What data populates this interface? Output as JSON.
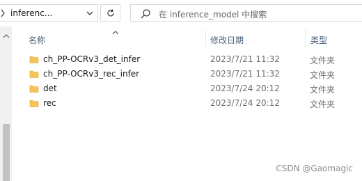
{
  "address_bar": {
    "path": "inferenc..."
  },
  "search": {
    "placeholder": "在 inference_model 中搜索"
  },
  "columns": {
    "name": "名称",
    "date": "修改日期",
    "type": "类型"
  },
  "files": [
    {
      "name": "ch_PP-OCRv3_det_infer",
      "date": "2023/7/21 11:32",
      "type": "文件夹"
    },
    {
      "name": "ch_PP-OCRv3_rec_infer",
      "date": "2023/7/21 11:32",
      "type": "文件夹"
    },
    {
      "name": "det",
      "date": "2023/7/24 20:12",
      "type": "文件夹"
    },
    {
      "name": "rec",
      "date": "2023/7/24 20:12",
      "type": "文件夹"
    }
  ],
  "watermark": "CSDN @Gaomagic",
  "colors": {
    "folder": "#f4c35a",
    "folder_dark": "#e0a93a",
    "header_text": "#4c607a"
  }
}
